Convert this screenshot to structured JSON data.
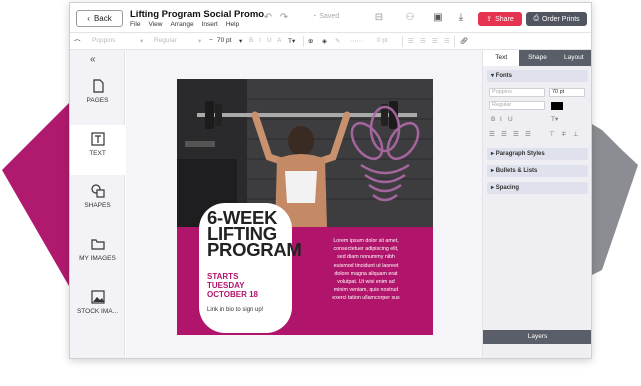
{
  "header": {
    "back_label": "Back",
    "title": "Lifting Program Social Promo",
    "menu": [
      "File",
      "View",
      "Arrange",
      "Insert",
      "Help"
    ],
    "saved_label": "Saved",
    "share_label": "Share",
    "order_label": "Order Prints"
  },
  "format_bar": {
    "font": "Poppins",
    "weight": "Regular",
    "size": "70 pt",
    "spacing": "0 pt"
  },
  "sidebar": {
    "items": [
      {
        "label": "PAGES",
        "icon": "page-icon"
      },
      {
        "label": "TEXT",
        "icon": "text-icon"
      },
      {
        "label": "SHAPES",
        "icon": "shapes-icon"
      },
      {
        "label": "MY IMAGES",
        "icon": "folder-icon"
      },
      {
        "label": "STOCK IMA...",
        "icon": "image-icon"
      }
    ]
  },
  "poster": {
    "headline": [
      "6-WEEK",
      "LIFTING",
      "PROGRAM"
    ],
    "starts": [
      "STARTS",
      "TUESDAY",
      "OCTOBER 18"
    ],
    "link_text": "Link in bio to sign up!",
    "lorem": [
      "Lorem ipsum dolor sit amet,",
      "consectetuer adipiscing elit,",
      "sed diam nonummy nibh",
      "euismod tincidunt ut laoreet",
      "dolore magna aliquam erat",
      "volutpat. Ut wisi enim ad",
      "minim veniam, quis nostrud",
      "exerci tation ullamcorper sus"
    ],
    "brand_color": "#b0156b",
    "ribbon_color": "#b01a6e"
  },
  "right_panel": {
    "tabs": [
      "Text",
      "Shape",
      "Layout"
    ],
    "active_tab": "Text",
    "fonts_label": "Fonts",
    "font": "Poppins",
    "size": "70 pt",
    "weight": "Regular",
    "paragraph_label": "Paragraph Styles",
    "bullets_label": "Bullets & Lists",
    "spacing_label": "Spacing",
    "layers_label": "Layers"
  }
}
